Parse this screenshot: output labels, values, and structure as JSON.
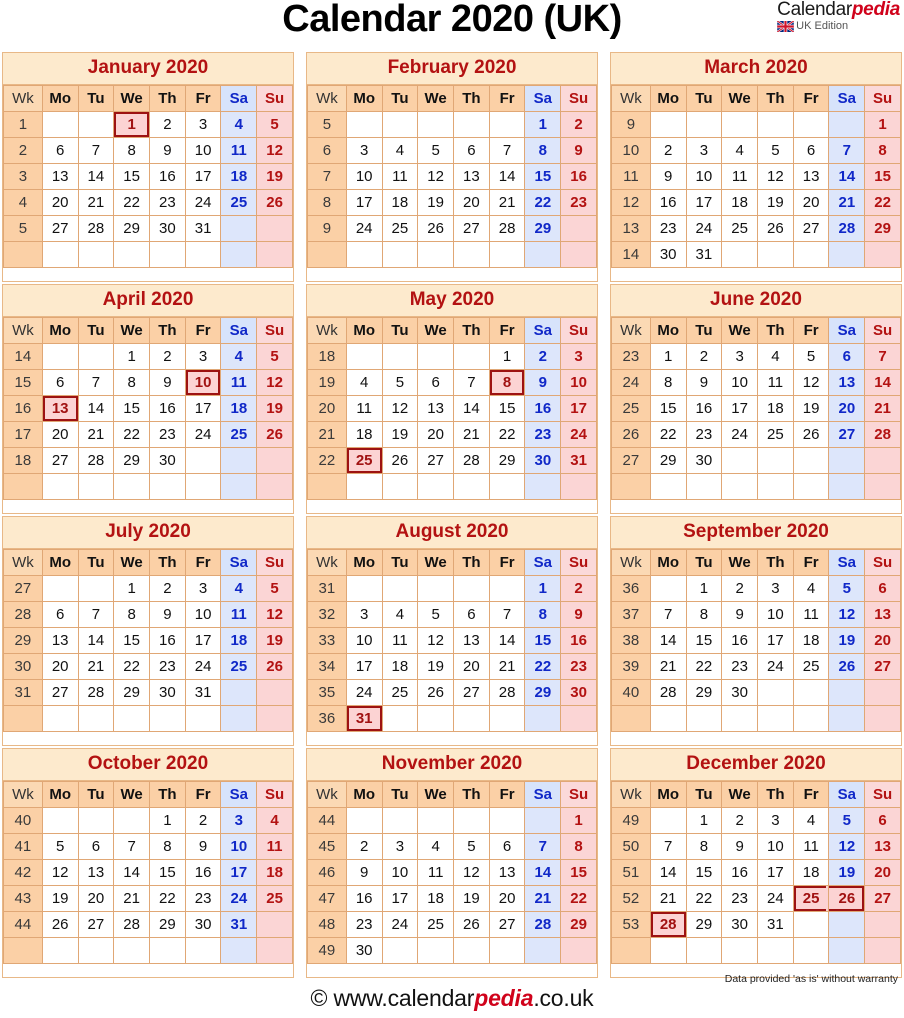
{
  "header": {
    "title": "Calendar 2020 (UK)",
    "brand_name": "Calendar",
    "brand_name_accent": "pedia",
    "edition": "UK Edition",
    "flag_icon": "uk-flag-icon"
  },
  "colors": {
    "title_text": "#000000",
    "month_title_text": "#b31212",
    "month_title_bg": "#fdeacd",
    "week_col_bg": "#fbd0a6",
    "weekday_header_bg": "#fbd0a6",
    "saturday_bg": "#dde6fb",
    "saturday_text": "#1028c8",
    "sunday_bg": "#fbd5d5",
    "sunday_text": "#b31212",
    "holiday_bg": "#fcd3d3",
    "holiday_border": "#9d1212",
    "holiday_text": "#a11212",
    "grid_border": "#e0a775",
    "accent_red": "#d0021b"
  },
  "weekday_headers": [
    "Wk",
    "Mo",
    "Tu",
    "We",
    "Th",
    "Fr",
    "Sa",
    "Su"
  ],
  "footer": {
    "disclaimer": "Data provided 'as is' without warranty",
    "copyright_prefix": "© www.calendar",
    "copyright_accent": "pedia",
    "copyright_suffix": ".co.uk"
  },
  "chart_data": {
    "type": "table",
    "title": "Calendar 2020 (UK)",
    "year": 2020,
    "week_start": "Monday",
    "months": [
      {
        "name": "January 2020",
        "weeks": [
          {
            "wk": "1",
            "days": [
              "",
              "",
              "1",
              "2",
              "3",
              "4",
              "5"
            ],
            "holidays": [
              2
            ]
          },
          {
            "wk": "2",
            "days": [
              "6",
              "7",
              "8",
              "9",
              "10",
              "11",
              "12"
            ],
            "holidays": []
          },
          {
            "wk": "3",
            "days": [
              "13",
              "14",
              "15",
              "16",
              "17",
              "18",
              "19"
            ],
            "holidays": []
          },
          {
            "wk": "4",
            "days": [
              "20",
              "21",
              "22",
              "23",
              "24",
              "25",
              "26"
            ],
            "holidays": []
          },
          {
            "wk": "5",
            "days": [
              "27",
              "28",
              "29",
              "30",
              "31",
              "",
              ""
            ],
            "holidays": []
          },
          {
            "wk": "",
            "days": [
              "",
              "",
              "",
              "",
              "",
              "",
              ""
            ],
            "holidays": []
          }
        ]
      },
      {
        "name": "February 2020",
        "weeks": [
          {
            "wk": "5",
            "days": [
              "",
              "",
              "",
              "",
              "",
              "1",
              "2"
            ],
            "holidays": []
          },
          {
            "wk": "6",
            "days": [
              "3",
              "4",
              "5",
              "6",
              "7",
              "8",
              "9"
            ],
            "holidays": []
          },
          {
            "wk": "7",
            "days": [
              "10",
              "11",
              "12",
              "13",
              "14",
              "15",
              "16"
            ],
            "holidays": []
          },
          {
            "wk": "8",
            "days": [
              "17",
              "18",
              "19",
              "20",
              "21",
              "22",
              "23"
            ],
            "holidays": []
          },
          {
            "wk": "9",
            "days": [
              "24",
              "25",
              "26",
              "27",
              "28",
              "29",
              ""
            ],
            "holidays": []
          },
          {
            "wk": "",
            "days": [
              "",
              "",
              "",
              "",
              "",
              "",
              ""
            ],
            "holidays": []
          }
        ]
      },
      {
        "name": "March 2020",
        "weeks": [
          {
            "wk": "9",
            "days": [
              "",
              "",
              "",
              "",
              "",
              "",
              "1"
            ],
            "holidays": []
          },
          {
            "wk": "10",
            "days": [
              "2",
              "3",
              "4",
              "5",
              "6",
              "7",
              "8"
            ],
            "holidays": []
          },
          {
            "wk": "11",
            "days": [
              "9",
              "10",
              "11",
              "12",
              "13",
              "14",
              "15"
            ],
            "holidays": []
          },
          {
            "wk": "12",
            "days": [
              "16",
              "17",
              "18",
              "19",
              "20",
              "21",
              "22"
            ],
            "holidays": []
          },
          {
            "wk": "13",
            "days": [
              "23",
              "24",
              "25",
              "26",
              "27",
              "28",
              "29"
            ],
            "holidays": []
          },
          {
            "wk": "14",
            "days": [
              "30",
              "31",
              "",
              "",
              "",
              "",
              ""
            ],
            "holidays": []
          }
        ]
      },
      {
        "name": "April 2020",
        "weeks": [
          {
            "wk": "14",
            "days": [
              "",
              "",
              "1",
              "2",
              "3",
              "4",
              "5"
            ],
            "holidays": []
          },
          {
            "wk": "15",
            "days": [
              "6",
              "7",
              "8",
              "9",
              "10",
              "11",
              "12"
            ],
            "holidays": [
              4
            ]
          },
          {
            "wk": "16",
            "days": [
              "13",
              "14",
              "15",
              "16",
              "17",
              "18",
              "19"
            ],
            "holidays": [
              0
            ]
          },
          {
            "wk": "17",
            "days": [
              "20",
              "21",
              "22",
              "23",
              "24",
              "25",
              "26"
            ],
            "holidays": []
          },
          {
            "wk": "18",
            "days": [
              "27",
              "28",
              "29",
              "30",
              "",
              "",
              ""
            ],
            "holidays": []
          },
          {
            "wk": "",
            "days": [
              "",
              "",
              "",
              "",
              "",
              "",
              ""
            ],
            "holidays": []
          }
        ]
      },
      {
        "name": "May 2020",
        "weeks": [
          {
            "wk": "18",
            "days": [
              "",
              "",
              "",
              "",
              "1",
              "2",
              "3"
            ],
            "holidays": []
          },
          {
            "wk": "19",
            "days": [
              "4",
              "5",
              "6",
              "7",
              "8",
              "9",
              "10"
            ],
            "holidays": [
              4
            ]
          },
          {
            "wk": "20",
            "days": [
              "11",
              "12",
              "13",
              "14",
              "15",
              "16",
              "17"
            ],
            "holidays": []
          },
          {
            "wk": "21",
            "days": [
              "18",
              "19",
              "20",
              "21",
              "22",
              "23",
              "24"
            ],
            "holidays": []
          },
          {
            "wk": "22",
            "days": [
              "25",
              "26",
              "27",
              "28",
              "29",
              "30",
              "31"
            ],
            "holidays": [
              0
            ]
          },
          {
            "wk": "",
            "days": [
              "",
              "",
              "",
              "",
              "",
              "",
              ""
            ],
            "holidays": []
          }
        ]
      },
      {
        "name": "June 2020",
        "weeks": [
          {
            "wk": "23",
            "days": [
              "1",
              "2",
              "3",
              "4",
              "5",
              "6",
              "7"
            ],
            "holidays": []
          },
          {
            "wk": "24",
            "days": [
              "8",
              "9",
              "10",
              "11",
              "12",
              "13",
              "14"
            ],
            "holidays": []
          },
          {
            "wk": "25",
            "days": [
              "15",
              "16",
              "17",
              "18",
              "19",
              "20",
              "21"
            ],
            "holidays": []
          },
          {
            "wk": "26",
            "days": [
              "22",
              "23",
              "24",
              "25",
              "26",
              "27",
              "28"
            ],
            "holidays": []
          },
          {
            "wk": "27",
            "days": [
              "29",
              "30",
              "",
              "",
              "",
              "",
              ""
            ],
            "holidays": []
          },
          {
            "wk": "",
            "days": [
              "",
              "",
              "",
              "",
              "",
              "",
              ""
            ],
            "holidays": []
          }
        ]
      },
      {
        "name": "July 2020",
        "weeks": [
          {
            "wk": "27",
            "days": [
              "",
              "",
              "1",
              "2",
              "3",
              "4",
              "5"
            ],
            "holidays": []
          },
          {
            "wk": "28",
            "days": [
              "6",
              "7",
              "8",
              "9",
              "10",
              "11",
              "12"
            ],
            "holidays": []
          },
          {
            "wk": "29",
            "days": [
              "13",
              "14",
              "15",
              "16",
              "17",
              "18",
              "19"
            ],
            "holidays": []
          },
          {
            "wk": "30",
            "days": [
              "20",
              "21",
              "22",
              "23",
              "24",
              "25",
              "26"
            ],
            "holidays": []
          },
          {
            "wk": "31",
            "days": [
              "27",
              "28",
              "29",
              "30",
              "31",
              "",
              ""
            ],
            "holidays": []
          },
          {
            "wk": "",
            "days": [
              "",
              "",
              "",
              "",
              "",
              "",
              ""
            ],
            "holidays": []
          }
        ]
      },
      {
        "name": "August 2020",
        "weeks": [
          {
            "wk": "31",
            "days": [
              "",
              "",
              "",
              "",
              "",
              "1",
              "2"
            ],
            "holidays": []
          },
          {
            "wk": "32",
            "days": [
              "3",
              "4",
              "5",
              "6",
              "7",
              "8",
              "9"
            ],
            "holidays": []
          },
          {
            "wk": "33",
            "days": [
              "10",
              "11",
              "12",
              "13",
              "14",
              "15",
              "16"
            ],
            "holidays": []
          },
          {
            "wk": "34",
            "days": [
              "17",
              "18",
              "19",
              "20",
              "21",
              "22",
              "23"
            ],
            "holidays": []
          },
          {
            "wk": "35",
            "days": [
              "24",
              "25",
              "26",
              "27",
              "28",
              "29",
              "30"
            ],
            "holidays": []
          },
          {
            "wk": "36",
            "days": [
              "31",
              "",
              "",
              "",
              "",
              "",
              ""
            ],
            "holidays": [
              0
            ]
          }
        ]
      },
      {
        "name": "September 2020",
        "weeks": [
          {
            "wk": "36",
            "days": [
              "",
              "1",
              "2",
              "3",
              "4",
              "5",
              "6"
            ],
            "holidays": []
          },
          {
            "wk": "37",
            "days": [
              "7",
              "8",
              "9",
              "10",
              "11",
              "12",
              "13"
            ],
            "holidays": []
          },
          {
            "wk": "38",
            "days": [
              "14",
              "15",
              "16",
              "17",
              "18",
              "19",
              "20"
            ],
            "holidays": []
          },
          {
            "wk": "39",
            "days": [
              "21",
              "22",
              "23",
              "24",
              "25",
              "26",
              "27"
            ],
            "holidays": []
          },
          {
            "wk": "40",
            "days": [
              "28",
              "29",
              "30",
              "",
              "",
              "",
              ""
            ],
            "holidays": []
          },
          {
            "wk": "",
            "days": [
              "",
              "",
              "",
              "",
              "",
              "",
              ""
            ],
            "holidays": []
          }
        ]
      },
      {
        "name": "October 2020",
        "weeks": [
          {
            "wk": "40",
            "days": [
              "",
              "",
              "",
              "1",
              "2",
              "3",
              "4"
            ],
            "holidays": []
          },
          {
            "wk": "41",
            "days": [
              "5",
              "6",
              "7",
              "8",
              "9",
              "10",
              "11"
            ],
            "holidays": []
          },
          {
            "wk": "42",
            "days": [
              "12",
              "13",
              "14",
              "15",
              "16",
              "17",
              "18"
            ],
            "holidays": []
          },
          {
            "wk": "43",
            "days": [
              "19",
              "20",
              "21",
              "22",
              "23",
              "24",
              "25"
            ],
            "holidays": []
          },
          {
            "wk": "44",
            "days": [
              "26",
              "27",
              "28",
              "29",
              "30",
              "31",
              ""
            ],
            "holidays": []
          },
          {
            "wk": "",
            "days": [
              "",
              "",
              "",
              "",
              "",
              "",
              ""
            ],
            "holidays": []
          }
        ]
      },
      {
        "name": "November 2020",
        "weeks": [
          {
            "wk": "44",
            "days": [
              "",
              "",
              "",
              "",
              "",
              "",
              "1"
            ],
            "holidays": []
          },
          {
            "wk": "45",
            "days": [
              "2",
              "3",
              "4",
              "5",
              "6",
              "7",
              "8"
            ],
            "holidays": []
          },
          {
            "wk": "46",
            "days": [
              "9",
              "10",
              "11",
              "12",
              "13",
              "14",
              "15"
            ],
            "holidays": []
          },
          {
            "wk": "47",
            "days": [
              "16",
              "17",
              "18",
              "19",
              "20",
              "21",
              "22"
            ],
            "holidays": []
          },
          {
            "wk": "48",
            "days": [
              "23",
              "24",
              "25",
              "26",
              "27",
              "28",
              "29"
            ],
            "holidays": []
          },
          {
            "wk": "49",
            "days": [
              "30",
              "",
              "",
              "",
              "",
              "",
              ""
            ],
            "holidays": []
          }
        ]
      },
      {
        "name": "December 2020",
        "weeks": [
          {
            "wk": "49",
            "days": [
              "",
              "1",
              "2",
              "3",
              "4",
              "5",
              "6"
            ],
            "holidays": []
          },
          {
            "wk": "50",
            "days": [
              "7",
              "8",
              "9",
              "10",
              "11",
              "12",
              "13"
            ],
            "holidays": []
          },
          {
            "wk": "51",
            "days": [
              "14",
              "15",
              "16",
              "17",
              "18",
              "19",
              "20"
            ],
            "holidays": []
          },
          {
            "wk": "52",
            "days": [
              "21",
              "22",
              "23",
              "24",
              "25",
              "26",
              "27"
            ],
            "holidays": [
              4,
              5
            ]
          },
          {
            "wk": "53",
            "days": [
              "28",
              "29",
              "30",
              "31",
              "",
              "",
              ""
            ],
            "holidays": [
              0
            ]
          },
          {
            "wk": "",
            "days": [
              "",
              "",
              "",
              "",
              "",
              "",
              ""
            ],
            "holidays": []
          }
        ]
      }
    ]
  }
}
